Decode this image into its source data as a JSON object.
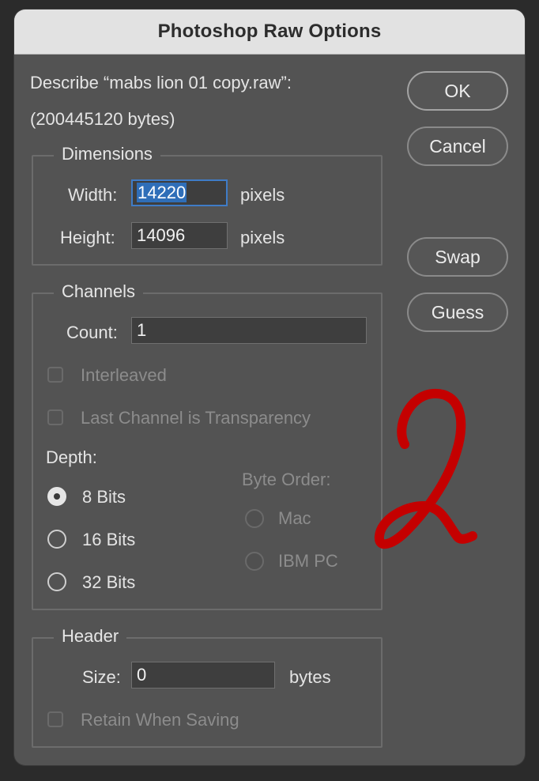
{
  "window": {
    "title": "Photoshop Raw Options"
  },
  "describe": {
    "line1": "Describe “mabs lion 01 copy.raw”:",
    "line2": "(200445120 bytes)"
  },
  "buttons": {
    "ok": "OK",
    "cancel": "Cancel",
    "swap": "Swap",
    "guess": "Guess"
  },
  "dimensions": {
    "legend": "Dimensions",
    "width_label": "Width:",
    "width_value": "14220",
    "width_unit": "pixels",
    "height_label": "Height:",
    "height_value": "14096",
    "height_unit": "pixels"
  },
  "channels": {
    "legend": "Channels",
    "count_label": "Count:",
    "count_value": "1",
    "interleaved_label": "Interleaved",
    "interleaved_checked": false,
    "transparency_label": "Last Channel is Transparency",
    "transparency_checked": false,
    "depth_label": "Depth:",
    "depth_options": [
      {
        "label": "8 Bits",
        "selected": true
      },
      {
        "label": "16 Bits",
        "selected": false
      },
      {
        "label": "32 Bits",
        "selected": false
      }
    ],
    "byte_order_label": "Byte Order:",
    "byte_order_options": [
      {
        "label": "Mac",
        "selected": false
      },
      {
        "label": "IBM PC",
        "selected": false
      }
    ]
  },
  "header": {
    "legend": "Header",
    "size_label": "Size:",
    "size_value": "0",
    "size_unit": "bytes",
    "retain_label": "Retain When Saving",
    "retain_checked": false
  },
  "annotation": {
    "color": "#c40000"
  },
  "colors": {
    "dialog_bg": "#535353",
    "titlebar_bg": "#e2e2e2",
    "focus_ring": "#3f7cc7"
  }
}
